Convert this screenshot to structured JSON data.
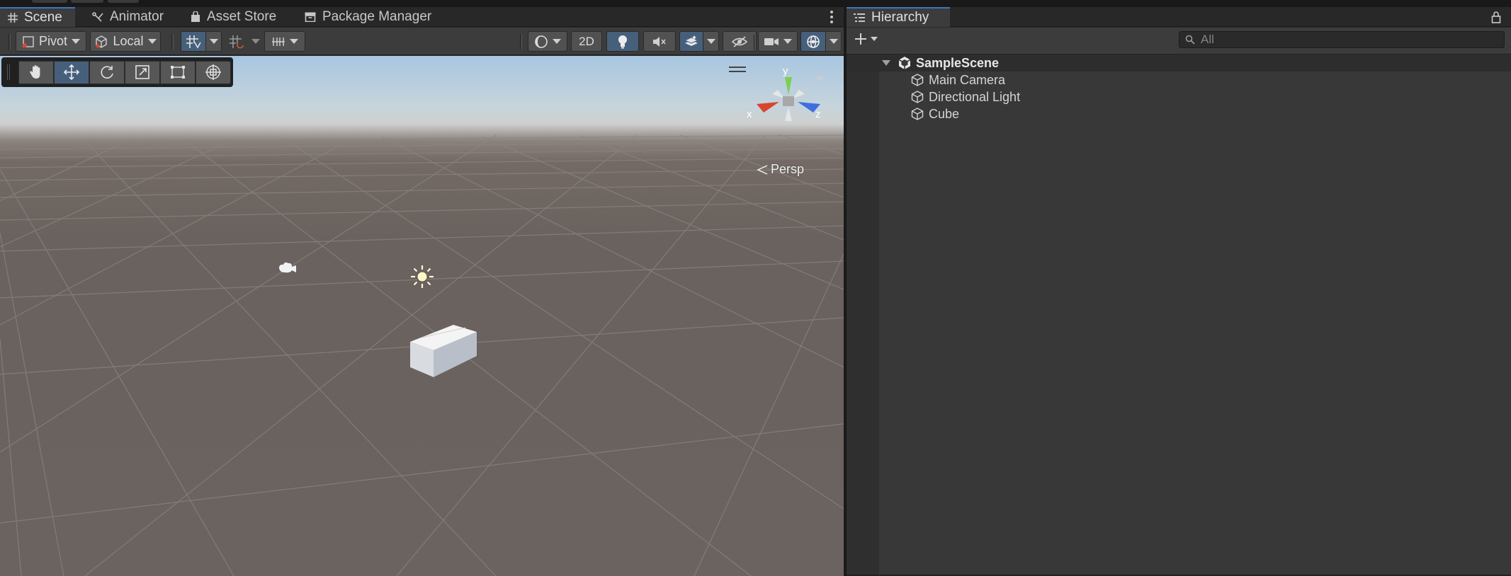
{
  "scene_panel": {
    "tabs": [
      {
        "label": "Scene",
        "icon": "grid-icon",
        "active": true
      },
      {
        "label": "Animator",
        "icon": "animator-icon",
        "active": false
      },
      {
        "label": "Asset Store",
        "icon": "shopping-bag-icon",
        "active": false
      },
      {
        "label": "Package Manager",
        "icon": "package-icon",
        "active": false
      }
    ],
    "toolbar": {
      "pivot_label": "Pivot",
      "local_label": "Local",
      "mode_2d_label": "2D"
    },
    "tools": [
      "hand-tool",
      "move-tool",
      "rotate-tool",
      "scale-tool",
      "rect-tool",
      "transform-tool"
    ],
    "active_tool": "move-tool",
    "gizmo": {
      "axis_y": "y",
      "axis_x": "x",
      "axis_z": "z",
      "colors": {
        "y": "#7bd04e",
        "x": "#d8452f",
        "z": "#3f6ee0"
      }
    },
    "projection_label": "Persp"
  },
  "hierarchy": {
    "tab_label": "Hierarchy",
    "search_placeholder": "All",
    "scene_name": "SampleScene",
    "items": [
      {
        "label": "Main Camera",
        "icon": "gameobject-cube-icon"
      },
      {
        "label": "Directional Light",
        "icon": "gameobject-cube-icon"
      },
      {
        "label": "Cube",
        "icon": "gameobject-cube-icon"
      }
    ]
  },
  "colors": {
    "accent": "#3a79bb",
    "toggle_on": "#46607c",
    "panel_bg": "#282828",
    "toolbar_bg": "#3c3c3c"
  }
}
